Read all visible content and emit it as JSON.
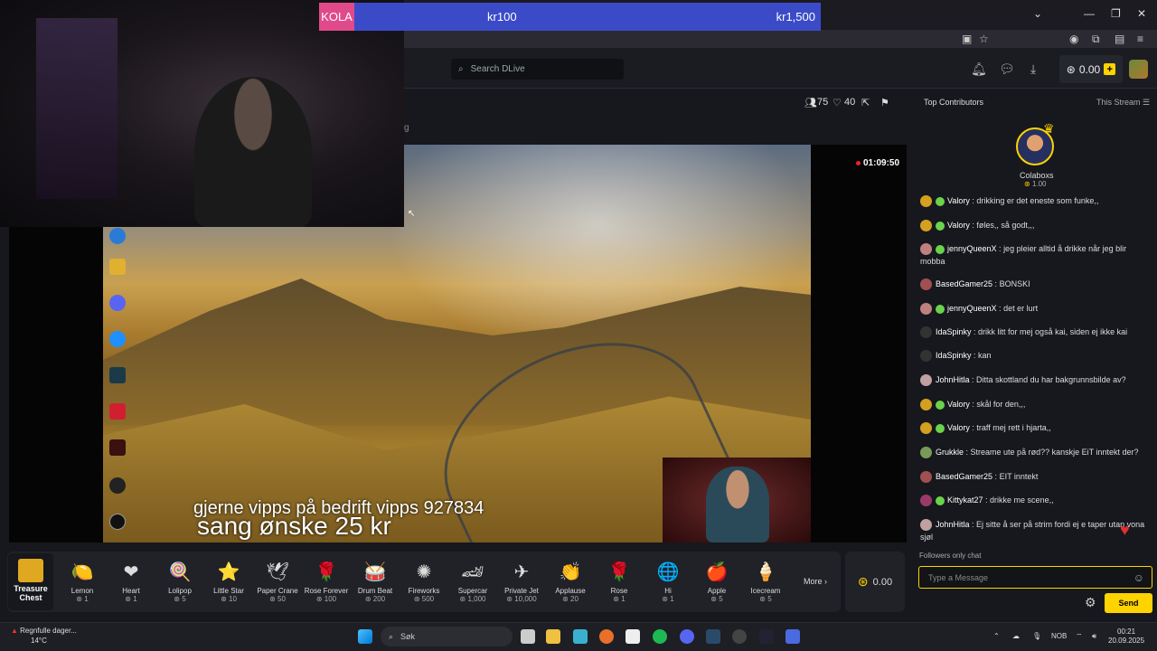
{
  "goal": {
    "tag": "KOLA",
    "current": "kr100",
    "target": "kr1,500"
  },
  "header": {
    "search_placeholder": "Search DLive",
    "balance": "0.00"
  },
  "stream": {
    "viewers": "75",
    "likes": "40",
    "timer": "01:09:50",
    "tab_fragment": "g",
    "overlay_line1": "gjerne vipps på bedrift  vipps 927834",
    "overlay_line2": "sang ønske 25 kr"
  },
  "treasure_chest": {
    "label": "Treasure Chest"
  },
  "gifts": [
    {
      "name": "Lemon",
      "price": "1",
      "icon": "🍋"
    },
    {
      "name": "Heart",
      "price": "1",
      "icon": "❤"
    },
    {
      "name": "Lolipop",
      "price": "5",
      "icon": "🍭"
    },
    {
      "name": "Little Star",
      "price": "10",
      "icon": "⭐"
    },
    {
      "name": "Paper Crane",
      "price": "50",
      "icon": "🕊"
    },
    {
      "name": "Rose Forever",
      "price": "100",
      "icon": "🌹"
    },
    {
      "name": "Drum Beat",
      "price": "200",
      "icon": "🥁"
    },
    {
      "name": "Fireworks",
      "price": "500",
      "icon": "✺"
    },
    {
      "name": "Supercar",
      "price": "1,000",
      "icon": "🏎"
    },
    {
      "name": "Private Jet",
      "price": "10,000",
      "icon": "✈"
    },
    {
      "name": "Applause",
      "price": "20",
      "icon": "👏"
    },
    {
      "name": "Rose",
      "price": "1",
      "icon": "🌹"
    },
    {
      "name": "Hi",
      "price": "1",
      "icon": "🌐"
    },
    {
      "name": "Apple",
      "price": "5",
      "icon": "🍎"
    },
    {
      "name": "Icecream",
      "price": "5",
      "icon": "🍦"
    }
  ],
  "gift_more": "More",
  "gift_balance": "0.00",
  "panel": {
    "top_contributors": "Top Contributors",
    "this_stream": "This Stream",
    "top_name": "Colaboxs",
    "top_amount": "1.00"
  },
  "chat": [
    {
      "user": "Valory",
      "text": "drikking er det eneste som funke,,",
      "badge": true
    },
    {
      "user": "Valory",
      "text": "føles,, så godt,,,",
      "badge": true
    },
    {
      "user": "jennyQueenX",
      "text": "jeg pleier alltid å drikke når jeg blir mobba",
      "badge": true
    },
    {
      "user": "BasedGamer25",
      "text": "BONSKI",
      "badge": false
    },
    {
      "user": "jennyQueenX",
      "text": "det er lurt",
      "badge": true
    },
    {
      "user": "IdaSpinky",
      "text": "drikk litt for mej også kai, siden ej ikke kai",
      "badge": false
    },
    {
      "user": "IdaSpinky",
      "text": "kan",
      "badge": false
    },
    {
      "user": "JohnHitla",
      "text": "Ditta skottland du har bakgrunnsbilde av?",
      "badge": false
    },
    {
      "user": "Valory",
      "text": "skål for den,,,",
      "badge": true
    },
    {
      "user": "Valory",
      "text": "traff mej rett i hjarta,,",
      "badge": true
    },
    {
      "user": "Grukkle",
      "text": "Streame ute på rød?? kanskje EiT inntekt der?",
      "badge": false
    },
    {
      "user": "BasedGamer25",
      "text": "EIT inntekt",
      "badge": false
    },
    {
      "user": "Kittykat27",
      "text": "drikke me scene,,",
      "badge": true
    },
    {
      "user": "JohnHitla",
      "text": "Ej sitte å ser på strim fordi ej e taper utan vona sjøl",
      "badge": false
    }
  ],
  "chat_footer": {
    "followers_only": "Followers only chat",
    "placeholder": "Type a Message",
    "send": "Send"
  },
  "taskbar": {
    "weather_title": "Regnfulle dager...",
    "weather_temp": "14°C",
    "search": "Søk",
    "lang": "NOB",
    "time": "00:21",
    "date": "20.09.2025"
  }
}
